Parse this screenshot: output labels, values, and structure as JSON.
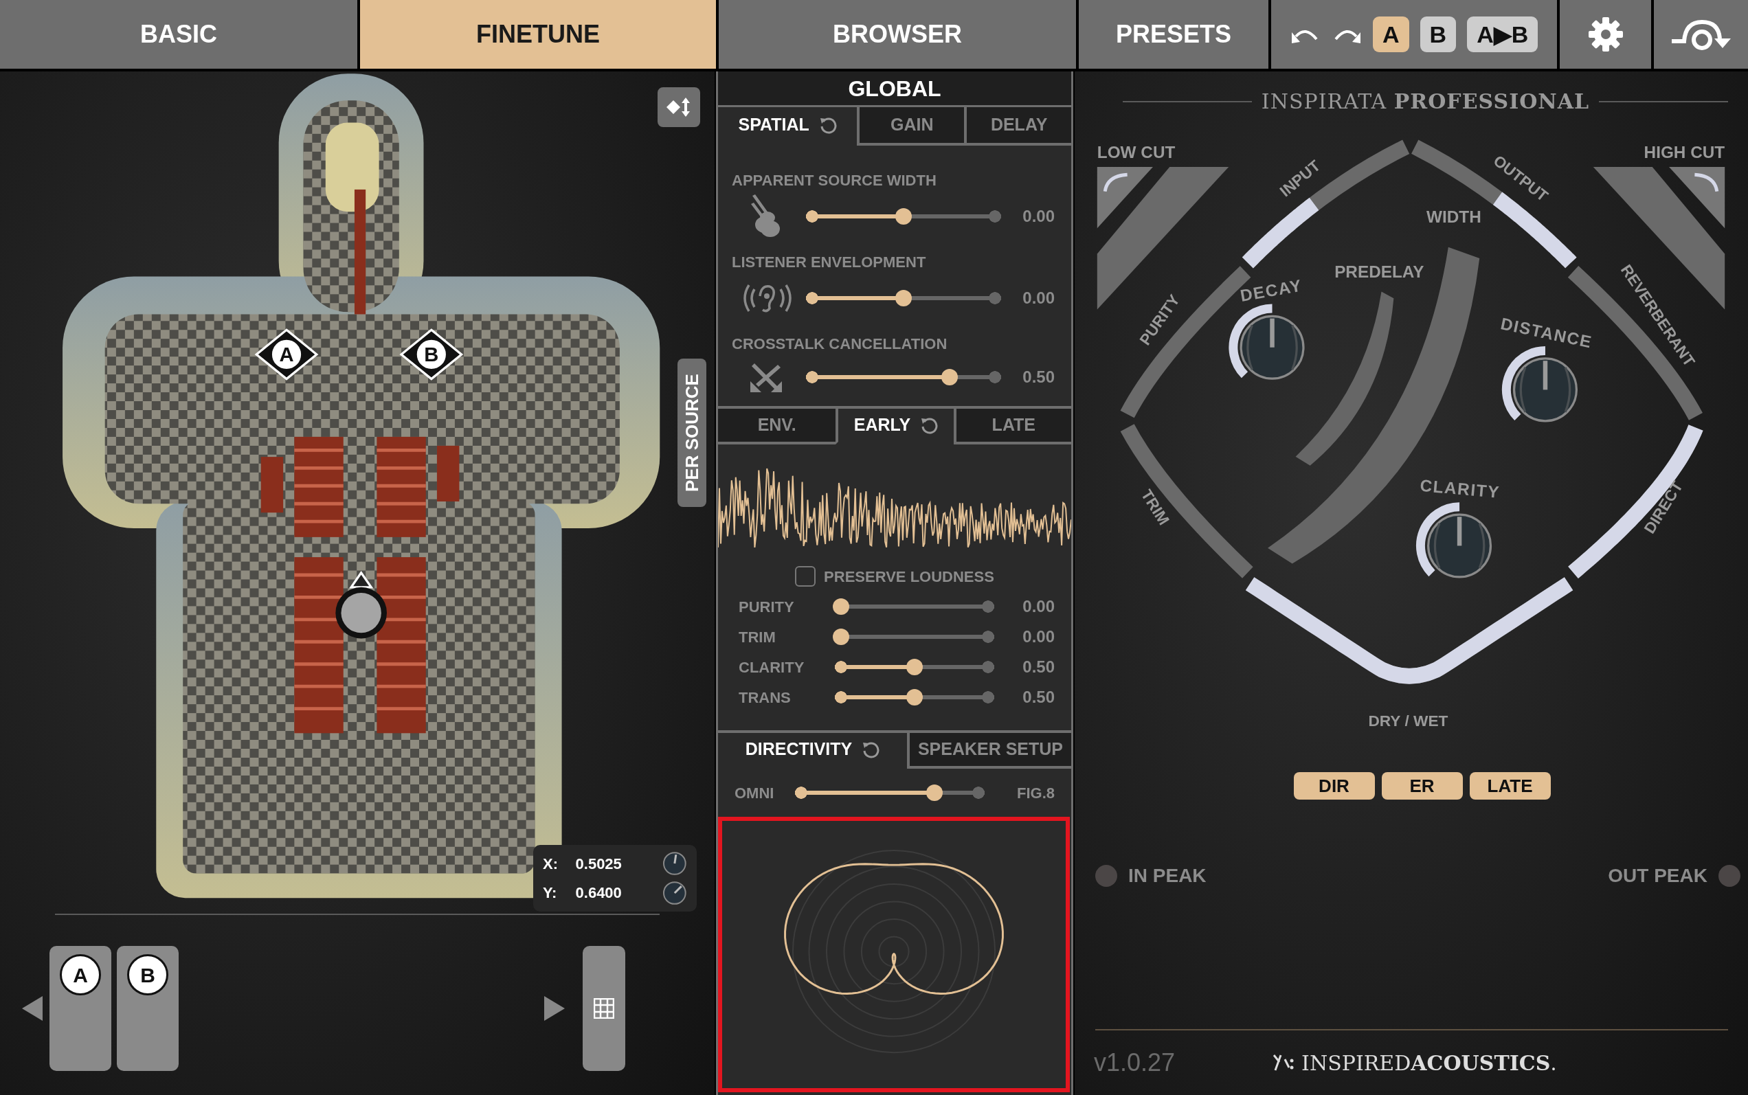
{
  "top_tabs": [
    {
      "label": "BASIC",
      "selected": false
    },
    {
      "label": "FINETUNE",
      "selected": true
    },
    {
      "label": "BROWSER",
      "selected": false
    },
    {
      "label": "PRESETS",
      "selected": false
    }
  ],
  "ab_buttons": [
    {
      "label": "A",
      "selected": true
    },
    {
      "label": "B",
      "selected": false
    },
    {
      "label": "A▶B",
      "selected": false
    }
  ],
  "room": {
    "sources": [
      {
        "label": "A"
      },
      {
        "label": "B"
      }
    ],
    "per_source_tab": "PER SOURCE",
    "coordinates": [
      {
        "label": "X:",
        "value": "0.5025"
      },
      {
        "label": "Y:",
        "value": "0.6400"
      }
    ],
    "source_cards": [
      {
        "label": "A"
      },
      {
        "label": "B"
      }
    ]
  },
  "global": {
    "title": "GLOBAL",
    "tabs": [
      {
        "label": "SPATIAL",
        "selected": true
      },
      {
        "label": "GAIN",
        "selected": false
      },
      {
        "label": "DELAY",
        "selected": false
      }
    ],
    "params": [
      {
        "label": "APPARENT SOURCE WIDTH",
        "level": 0.5,
        "reading": "0.00"
      },
      {
        "label": "LISTENER ENVELOPMENT",
        "level": 0.5,
        "reading": "0.00"
      },
      {
        "label": "CROSSTALK CANCELLATION",
        "level": 0.75,
        "reading": "0.50"
      }
    ]
  },
  "early": {
    "tabs": [
      {
        "label": "ENV.",
        "selected": false
      },
      {
        "label": "EARLY",
        "selected": true
      },
      {
        "label": "LATE",
        "selected": false
      }
    ],
    "preserve_loudness": {
      "label": "PRESERVE LOUDNESS",
      "checked": false
    },
    "params": [
      {
        "label": "PURITY",
        "level": 0,
        "reading": "0.00"
      },
      {
        "label": "TRIM",
        "level": 0,
        "reading": "0.00"
      },
      {
        "label": "CLARITY",
        "level": 0.5,
        "reading": "0.50"
      },
      {
        "label": "TRANS",
        "level": 0.5,
        "reading": "0.50"
      }
    ]
  },
  "directivity": {
    "tabs": [
      {
        "label": "DIRECTIVITY",
        "selected": true
      },
      {
        "label": "SPEAKER SETUP",
        "selected": false
      }
    ],
    "min_label": "OMNI",
    "max_label": "FIG.8",
    "level": 0.75,
    "polar_plot": {
      "highlighted": true
    }
  },
  "overview": {
    "title": "INSPIRATA **PROFESSIONAL**",
    "low_cut": "LOW CUT",
    "high_cut": "HIGH CUT",
    "segments": [
      {
        "label": "INPUT",
        "level": 0.45
      },
      {
        "label": "OUTPUT",
        "level": 0.5
      },
      {
        "label": "PURITY"
      },
      {
        "label": "TRIM"
      },
      {
        "label": "REVERBERANT"
      },
      {
        "label": "DIRECT",
        "level": 1
      },
      {
        "label": "DRY / WET",
        "level": 1
      }
    ],
    "bands": [
      {
        "label": "WIDTH"
      },
      {
        "label": "PREDELAY"
      }
    ],
    "knobs": [
      {
        "label": "DECAY",
        "level": 0.5
      },
      {
        "label": "DISTANCE",
        "level": 0.5
      },
      {
        "label": "CLARITY",
        "level": 0.5
      }
    ],
    "layer_buttons": [
      {
        "label": "DIR",
        "on": true
      },
      {
        "label": "ER",
        "on": true
      },
      {
        "label": "LATE",
        "on": true
      }
    ],
    "peaks": [
      {
        "label": "IN PEAK",
        "on": false
      },
      {
        "label": "OUT PEAK",
        "on": false
      }
    ],
    "version": "v1.0.27",
    "brand": "INSPIRED**ACOUSTICS**."
  }
}
